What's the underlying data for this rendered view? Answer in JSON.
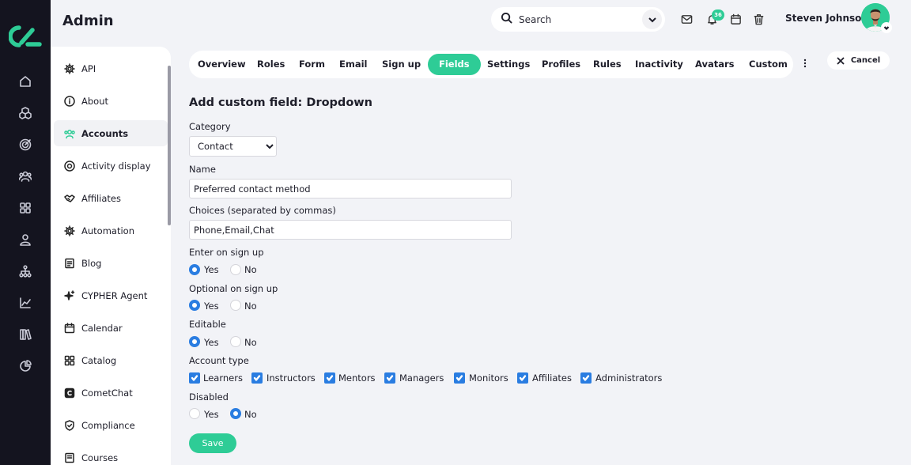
{
  "header": {
    "title": "Admin",
    "search_placeholder": "Search",
    "notification_count": "36",
    "user_name": "Steven Johnson"
  },
  "rail": {
    "icons": [
      "home-icon",
      "cubes-icon",
      "target-icon",
      "users-icon",
      "grid-icon",
      "user-icon",
      "sitemap-icon",
      "chart-line-icon",
      "books-icon",
      "pie-chart-icon"
    ]
  },
  "sidebar": {
    "items": [
      {
        "label": "API",
        "icon": "gear-icon"
      },
      {
        "label": "About",
        "icon": "info-icon"
      },
      {
        "label": "Accounts",
        "icon": "users-icon",
        "active": true
      },
      {
        "label": "Activity display",
        "icon": "target-icon"
      },
      {
        "label": "Affiliates",
        "icon": "handshake-icon"
      },
      {
        "label": "Automation",
        "icon": "gear-icon"
      },
      {
        "label": "Blog",
        "icon": "document-icon"
      },
      {
        "label": "CYPHER Agent",
        "icon": "sparkle-icon"
      },
      {
        "label": "Calendar",
        "icon": "calendar-icon"
      },
      {
        "label": "Catalog",
        "icon": "grid-icon"
      },
      {
        "label": "CometChat",
        "icon": "cometchat-icon"
      },
      {
        "label": "Compliance",
        "icon": "shield-icon"
      },
      {
        "label": "Courses",
        "icon": "book-icon"
      }
    ]
  },
  "tabs": [
    "Overview",
    "Roles",
    "Form",
    "Email",
    "Sign up",
    "Fields",
    "Settings",
    "Profiles",
    "Rules",
    "Inactivity",
    "Avatars",
    "Custom"
  ],
  "active_tab": "Fields",
  "cancel_label": "Cancel",
  "form": {
    "title": "Add custom field: Dropdown",
    "category_label": "Category",
    "category_value": "Contact",
    "name_label": "Name",
    "name_value": "Preferred contact method",
    "choices_label": "Choices (separated by commas)",
    "choices_value": "Phone,Email,Chat",
    "enter_label": "Enter on sign up",
    "optional_label": "Optional on sign up",
    "editable_label": "Editable",
    "account_type_label": "Account type",
    "disabled_label": "Disabled",
    "yes_label": "Yes",
    "no_label": "No",
    "enter_value": "Yes",
    "optional_value": "Yes",
    "editable_value": "Yes",
    "disabled_value": "No",
    "account_types": [
      "Learners",
      "Instructors",
      "Mentors",
      "Managers",
      "Monitors",
      "Affiliates",
      "Administrators"
    ],
    "save_label": "Save"
  },
  "colors": {
    "accent": "#2ecc96",
    "rail_bg": "#14141f",
    "control_blue": "#2a7de1",
    "page_bg": "#f2f3f7"
  }
}
